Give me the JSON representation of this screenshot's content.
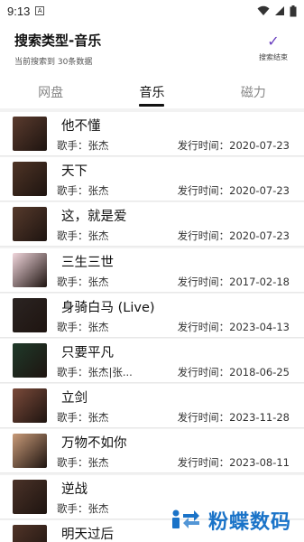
{
  "status": {
    "time": "9:13"
  },
  "header": {
    "title": "搜索类型-音乐",
    "subtitle": "当前搜索到 30条数据",
    "done_label": "搜索结束"
  },
  "tabs": [
    {
      "label": "网盘",
      "active": false
    },
    {
      "label": "音乐",
      "active": true
    },
    {
      "label": "磁力",
      "active": false
    }
  ],
  "songs": [
    {
      "title": "他不懂",
      "singer": "歌手：张杰",
      "date": "发行时间：2020-07-23",
      "cover": "#5a3b2e"
    },
    {
      "title": "天下",
      "singer": "歌手：张杰",
      "date": "发行时间：2020-07-23",
      "cover": "#4e3426"
    },
    {
      "title": "这，就是爱",
      "singer": "歌手：张杰",
      "date": "发行时间：2020-07-23",
      "cover": "#563a2c"
    },
    {
      "title": "三生三世",
      "singer": "歌手：张杰",
      "date": "发行时间：2017-02-18",
      "cover": "#f1d6dc"
    },
    {
      "title": "身骑白马 (Live)",
      "singer": "歌手：张杰",
      "date": "发行时间：2023-04-13",
      "cover": "#2b2422"
    },
    {
      "title": "只要平凡",
      "singer": "歌手：张杰|张...",
      "date": "发行时间：2018-06-25",
      "cover": "#1f3a2a"
    },
    {
      "title": "立剑",
      "singer": "歌手：张杰",
      "date": "发行时间：2023-11-28",
      "cover": "#7a4a3a"
    },
    {
      "title": "万物不如你",
      "singer": "歌手：张杰",
      "date": "发行时间：2023-08-11",
      "cover": "#c89a78"
    },
    {
      "title": "逆战",
      "singer": "歌手：张杰",
      "date": "",
      "cover": "#4a3228"
    },
    {
      "title": "明天过后",
      "singer": "",
      "date": "",
      "cover": "#503428"
    }
  ],
  "watermark": {
    "text": "粉蝶数码",
    "color": "#1a73c8"
  },
  "accent": "#6a3fc0"
}
